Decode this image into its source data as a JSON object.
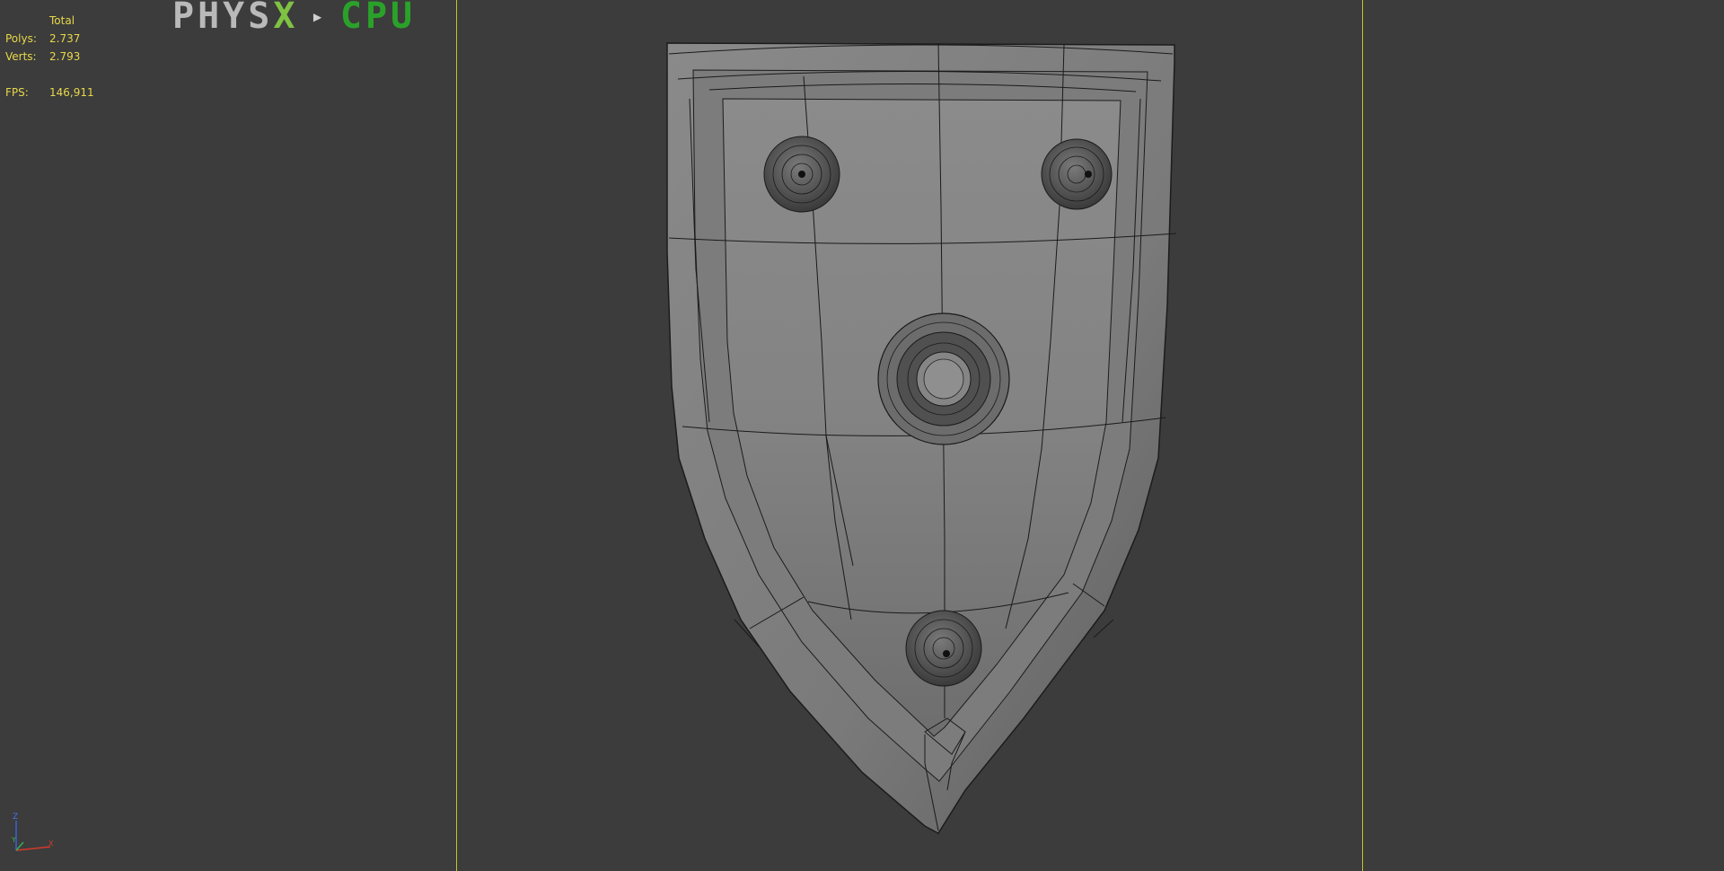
{
  "stats": {
    "header": "Total",
    "polys_label": "Polys:",
    "polys_value": "2.737",
    "verts_label": "Verts:",
    "verts_value": "2.793",
    "fps_label": "FPS:",
    "fps_value": "146,911"
  },
  "overlay": {
    "physx_text": "PHYS",
    "physx_x": "X",
    "separator": "▸",
    "cpu_text": "CPU"
  },
  "gizmo": {
    "z_label": "Z",
    "y_label": "Y",
    "x_label": "X"
  },
  "colors": {
    "background": "#3c3c3c",
    "stats_text": "#e8d84a",
    "safe_frame": "#c9c32a",
    "cpu_green": "#2aa22a"
  }
}
